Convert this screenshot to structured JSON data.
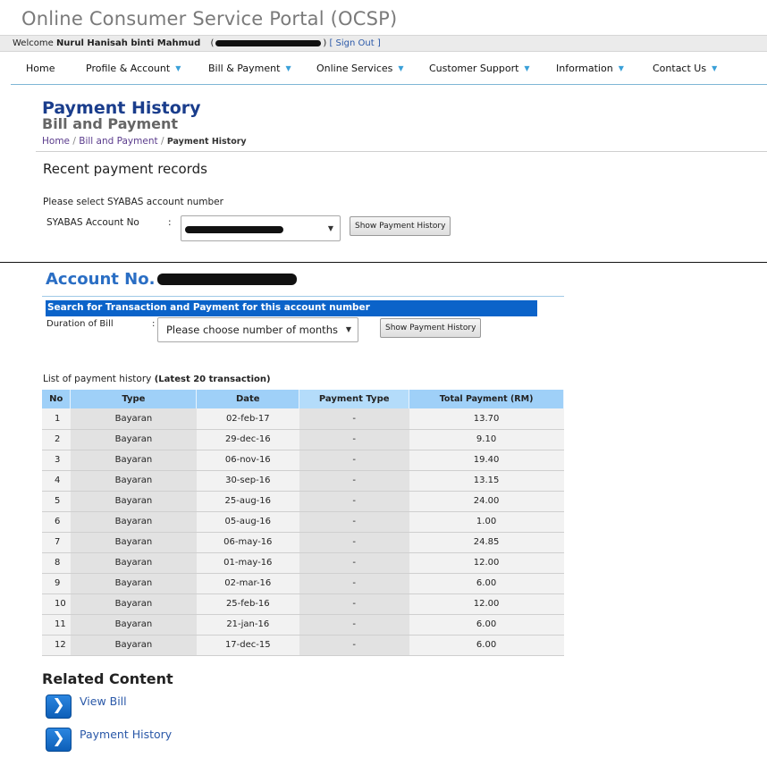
{
  "site": {
    "title": "Online Consumer Service Portal (OCSP)"
  },
  "welcome": {
    "prefix": "Welcome",
    "user": "Nurul Hanisah binti Mahmud",
    "open_paren": "(",
    "close_paren": ")",
    "sign_out": "[ Sign Out ]"
  },
  "nav": {
    "items": [
      {
        "label": "Home",
        "has_caret": false
      },
      {
        "label": "Profile & Account",
        "has_caret": true
      },
      {
        "label": "Bill & Payment",
        "has_caret": true
      },
      {
        "label": "Online Services",
        "has_caret": true
      },
      {
        "label": "Customer Support",
        "has_caret": true
      },
      {
        "label": "Information",
        "has_caret": true
      },
      {
        "label": "Contact Us",
        "has_caret": true
      }
    ],
    "caret": "▼"
  },
  "page": {
    "title": "Payment History",
    "subtitle": "Bill and Payment",
    "breadcrumb": {
      "home": "Home",
      "sep": "/",
      "section": "Bill and Payment",
      "current": "Payment History"
    }
  },
  "recent": {
    "title": "Recent payment records",
    "prompt": "Please select SYABAS account number",
    "account_label": "SYABAS Account No",
    "colon": ":",
    "show_button": "Show Payment History"
  },
  "account": {
    "label": "Account No.",
    "colon": ":"
  },
  "search": {
    "header": "Search for Transaction and Payment for this account number",
    "duration_label": "Duration of Bill",
    "colon": ":",
    "duration_placeholder": "Please choose number of months",
    "show_button": "Show Payment History"
  },
  "history": {
    "caption": "List of payment history",
    "caption_bold": "(Latest 20 transaction)",
    "columns": {
      "no": "No",
      "type": "Type",
      "date": "Date",
      "payment_type": "Payment Type",
      "total": "Total Payment (RM)"
    },
    "rows": [
      {
        "no": "1",
        "type": "Bayaran",
        "date": "02-feb-17",
        "payment_type": "-",
        "total": "13.70"
      },
      {
        "no": "2",
        "type": "Bayaran",
        "date": "29-dec-16",
        "payment_type": "-",
        "total": "9.10"
      },
      {
        "no": "3",
        "type": "Bayaran",
        "date": "06-nov-16",
        "payment_type": "-",
        "total": "19.40"
      },
      {
        "no": "4",
        "type": "Bayaran",
        "date": "30-sep-16",
        "payment_type": "-",
        "total": "13.15"
      },
      {
        "no": "5",
        "type": "Bayaran",
        "date": "25-aug-16",
        "payment_type": "-",
        "total": "24.00"
      },
      {
        "no": "6",
        "type": "Bayaran",
        "date": "05-aug-16",
        "payment_type": "-",
        "total": "1.00"
      },
      {
        "no": "7",
        "type": "Bayaran",
        "date": "06-may-16",
        "payment_type": "-",
        "total": "24.85"
      },
      {
        "no": "8",
        "type": "Bayaran",
        "date": "01-may-16",
        "payment_type": "-",
        "total": "12.00"
      },
      {
        "no": "9",
        "type": "Bayaran",
        "date": "02-mar-16",
        "payment_type": "-",
        "total": "6.00"
      },
      {
        "no": "10",
        "type": "Bayaran",
        "date": "25-feb-16",
        "payment_type": "-",
        "total": "12.00"
      },
      {
        "no": "11",
        "type": "Bayaran",
        "date": "21-jan-16",
        "payment_type": "-",
        "total": "6.00"
      },
      {
        "no": "12",
        "type": "Bayaran",
        "date": "17-dec-15",
        "payment_type": "-",
        "total": "6.00"
      }
    ]
  },
  "related": {
    "title": "Related Content",
    "links": [
      {
        "label": "View Bill",
        "icon": "chevron-right-icon"
      },
      {
        "label": "Payment History",
        "icon": "chevron-right-icon"
      }
    ],
    "arrow_glyph": "❯"
  },
  "colors": {
    "brand_blue": "#1a3d8c",
    "accent_blue": "#0b63c9",
    "header_light_blue": "#9fd0f8",
    "link_blue": "#2a58a8"
  }
}
